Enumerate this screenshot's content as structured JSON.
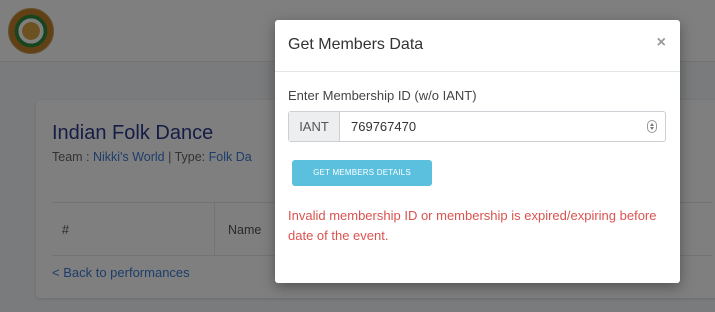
{
  "background": {
    "card_title": "Indian Folk Dance",
    "team_prefix": "Team : ",
    "team_name": "Nikki's World",
    "type_prefix": " | Type: ",
    "type_name": "Folk Da",
    "table_headers": [
      "#",
      "Name"
    ],
    "back_link": "< Back to performances"
  },
  "modal": {
    "title": "Get Members Data",
    "close_symbol": "×",
    "field_label": "Enter Membership ID (w/o IANT)",
    "input_prefix": "IANT",
    "input_value": "769767470",
    "button_label": "GET MEMBERS DETAILS",
    "error_message": "Invalid membership ID or membership is expired/expiring before date of the event."
  },
  "colors": {
    "accent_button": "#5bc0de",
    "error_text": "#d9534f",
    "link": "#3a7bd5",
    "heading": "#2b3a8c"
  },
  "icons": [
    "logo-emblem",
    "close-icon",
    "number-stepper-icon"
  ]
}
